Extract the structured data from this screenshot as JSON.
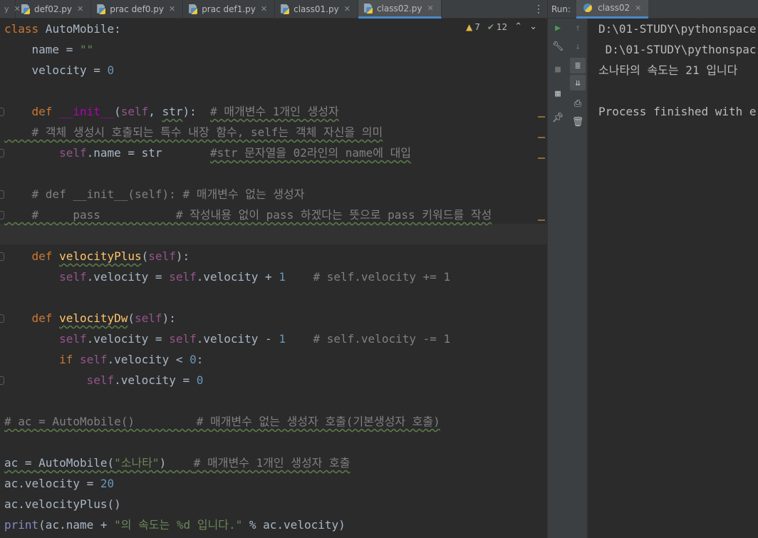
{
  "editor_tabs": [
    {
      "label": "def02.py"
    },
    {
      "label": "prac def0.py"
    },
    {
      "label": "prac def1.py"
    },
    {
      "label": "class01.py"
    },
    {
      "label": "class02.py",
      "active": true
    }
  ],
  "inspection": {
    "warnings": "7",
    "weak_warnings": "12"
  },
  "run": {
    "label": "Run:",
    "tab": "class02"
  },
  "console_lines": [
    "D:\\01-STUDY\\pythonspace",
    " D:\\01-STUDY\\pythonspac",
    "소나타의 속도는 21 입니다",
    "",
    "Process finished with e"
  ],
  "code": {
    "l1_kw": "class",
    "l1_name": " AutoMobile:",
    "l2": "    name = ",
    "l2_str": "\"\"",
    "l3": "    velocity = ",
    "l3_num": "0",
    "l5_kw": "    def ",
    "l5_magic": "__init__",
    "l5_p1": "(",
    "l5_self": "self",
    "l5_p2": ", ",
    "l5_arg": "str",
    "l5_p3": "):  ",
    "l5_cmt": "# 매개변수 1개인 생성자",
    "l6_cmt": "    # 객체 생성시 호출되는 특수 내장 함수, self는 객체 자신을 의미",
    "l7_self": "        self",
    "l7_rest": ".name = str       ",
    "l7_cmt": "#str 문자열을 02라인의 name에 대입",
    "l9_cmt": "    # def __init__(self): # 매개변수 없는 생성자",
    "l10_cmt": "    #     pass           # 작성내용 없이 pass 하겠다는 뜻으로 pass 키워드를 작성",
    "l12_kw": "    def ",
    "l12_fn": "velocityPlus",
    "l12_p1": "(",
    "l12_self": "self",
    "l12_p2": "):",
    "l13_self1": "        self",
    "l13_mid": ".velocity = ",
    "l13_self2": "self",
    "l13_op": ".velocity + ",
    "l13_num": "1",
    "l13_cmt": "    # self.velocity += 1",
    "l15_kw": "    def ",
    "l15_fn": "velocityDw",
    "l15_p1": "(",
    "l15_self": "self",
    "l15_p2": "):",
    "l16_self1": "        self",
    "l16_mid": ".velocity = ",
    "l16_self2": "self",
    "l16_op": ".velocity - ",
    "l16_num": "1",
    "l16_cmt": "    # self.velocity -= 1",
    "l17_kw": "        if ",
    "l17_self": "self",
    "l17_op": ".velocity < ",
    "l17_num": "0",
    "l17_end": ":",
    "l18_self": "            self",
    "l18_op": ".velocity = ",
    "l18_num": "0",
    "l20_cmt": "# ac = AutoMobile()         # 매개변수 없는 생성자 호출(기본생성자 호출)",
    "l22_a": "ac = AutoMobile(",
    "l22_str": "\"소나타\"",
    "l22_b": ")    ",
    "l22_cmt": "# 매개변수 1개인 생성자 호출",
    "l23_a": "ac.velocity = ",
    "l23_num": "20",
    "l24": "ac.velocityPlus()",
    "l25_fn": "print",
    "l25_a": "(ac.name + ",
    "l25_str": "\"의 속도는 %d 입니다.\"",
    "l25_b": " % ac.velocity)"
  },
  "colors": {
    "background": "#2b2b2b",
    "keyword": "#cc7832",
    "self": "#94558d",
    "function": "#ffc66d",
    "number": "#6897bb",
    "string": "#6a8759",
    "comment": "#808080",
    "accent": "#4a88c7"
  }
}
